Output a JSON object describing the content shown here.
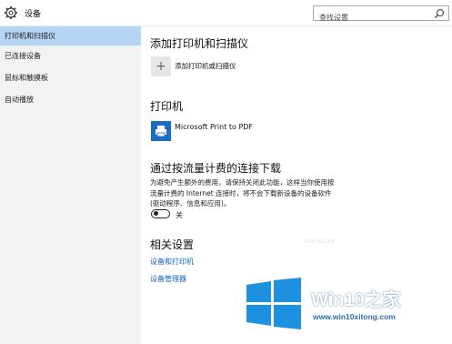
{
  "window": {
    "title": "设备",
    "search_placeholder": "查找设置"
  },
  "sidebar": {
    "items": [
      {
        "label": "打印机和扫描仪",
        "active": true
      },
      {
        "label": "已连接设备",
        "active": false
      },
      {
        "label": "鼠标和触摸板",
        "active": false
      },
      {
        "label": "自动播放",
        "active": false
      }
    ]
  },
  "main": {
    "section_printers_scanners": "添加打印机和扫描仪",
    "add_button_label": "添加打印机或扫描仪",
    "section_printers": "打印机",
    "printer_name": "Microsoft Print to PDF",
    "section_metered": "通过按流量计费的连接下载",
    "metered_description": "为避免产生额外的费用，请保持关闭此功能，这样当你使用按流量计费的 Internet 连接时，将不会下载新设备的设备软件(驱动程序、信息和应用)。",
    "toggle_state": "关",
    "toggle_on": false,
    "section_related": "相关设置",
    "link_devices_printers": "设备和打印机",
    "link_device_manager": "设备管理器"
  },
  "watermark": {
    "title": "Win10之家",
    "url": "www.win10xitong.com",
    "faint": "xxx.xx.xx"
  },
  "colors": {
    "sidebar_bg": "#f2f2f2",
    "active_item": "#b4d6f4",
    "link": "#1565c0",
    "printer_tile": "#1a6fc4",
    "windows_logo": "#1e90e0"
  }
}
